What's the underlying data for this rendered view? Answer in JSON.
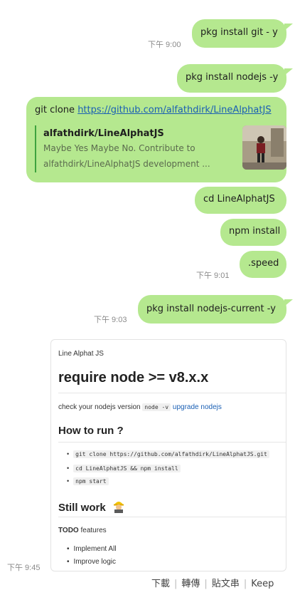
{
  "messages": {
    "m1": {
      "text": "pkg install git - y",
      "time": "下午 9:00"
    },
    "m2": {
      "text": "pkg install nodejs -y"
    },
    "m3": {
      "prefix": "git clone ",
      "link": "https://github.com/alfathdirk/LineAlphatJS",
      "preview_title": "alfathdirk/LineAlphatJS",
      "preview_desc": "Maybe Yes Maybe No. Contribute to alfathdirk/LineAlphatJS development ..."
    },
    "m4": {
      "text": "cd LineAlphatJS"
    },
    "m5": {
      "text": "npm install"
    },
    "m6": {
      "text": ".speed",
      "time": "下午 9:01"
    },
    "m7": {
      "text": "pkg install nodejs-current -y",
      "time": "下午 9:03"
    },
    "m8": {
      "time": "下午 9:45"
    }
  },
  "image_message": {
    "repo_title": "Line Alphat JS",
    "heading": "require node >= v8.x.x",
    "check_text": "check your nodejs version",
    "check_code": "node -v",
    "check_link": "upgrade nodejs",
    "how_heading": "How to run ?",
    "steps": [
      "git clone https://github.com/alfathdirk/LineAlphatJS.git",
      "cd LineAlphatJS && npm install",
      "npm start"
    ],
    "still_heading": "Still work",
    "todo_label": "TODO",
    "todo_suffix": " features",
    "todo_items": [
      "Implement All",
      "Improve logic"
    ]
  },
  "actions": {
    "download": "下載",
    "forward": "轉傳",
    "post": "貼文串",
    "keep": "Keep"
  },
  "colors": {
    "bubble": "#b5e88f",
    "link": "#1a5fb4",
    "preview_bar": "#3ea33e"
  }
}
